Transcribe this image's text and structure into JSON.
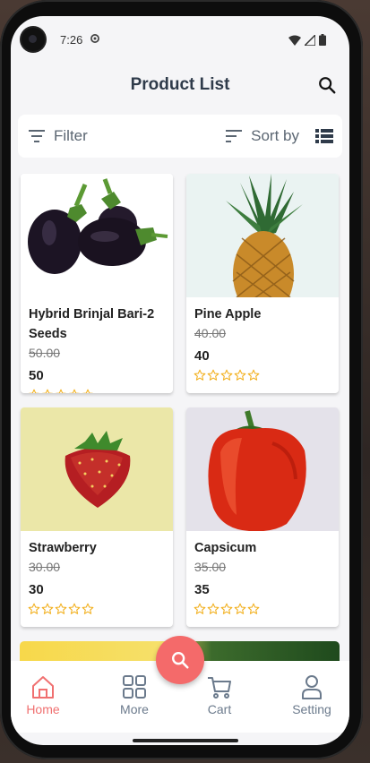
{
  "status": {
    "time": "7:26"
  },
  "appbar": {
    "title": "Product List",
    "search_icon": "search-icon"
  },
  "filterbar": {
    "filter_label": "Filter",
    "sort_label": "Sort by",
    "view_icon": "list-view-icon"
  },
  "products": [
    {
      "name": "Hybrid Brinjal Bari-2 Seeds",
      "old_price": "50.00",
      "price": "50",
      "rating": 0
    },
    {
      "name": "Pine Apple",
      "old_price": "40.00",
      "price": "40",
      "rating": 0
    },
    {
      "name": "Strawberry",
      "old_price": "30.00",
      "price": "30",
      "rating": 0
    },
    {
      "name": "Capsicum",
      "old_price": "35.00",
      "price": "35",
      "rating": 0
    }
  ],
  "nav": {
    "items": [
      {
        "label": "Home",
        "icon": "home-icon",
        "active": true
      },
      {
        "label": "More",
        "icon": "grid-icon",
        "active": false
      },
      {
        "label": "Cart",
        "icon": "cart-icon",
        "active": false
      },
      {
        "label": "Setting",
        "icon": "user-icon",
        "active": false
      }
    ],
    "fab_icon": "search-icon"
  },
  "colors": {
    "accent": "#f46a6a",
    "title": "#2f3b4a",
    "star": "#f2b01e"
  }
}
